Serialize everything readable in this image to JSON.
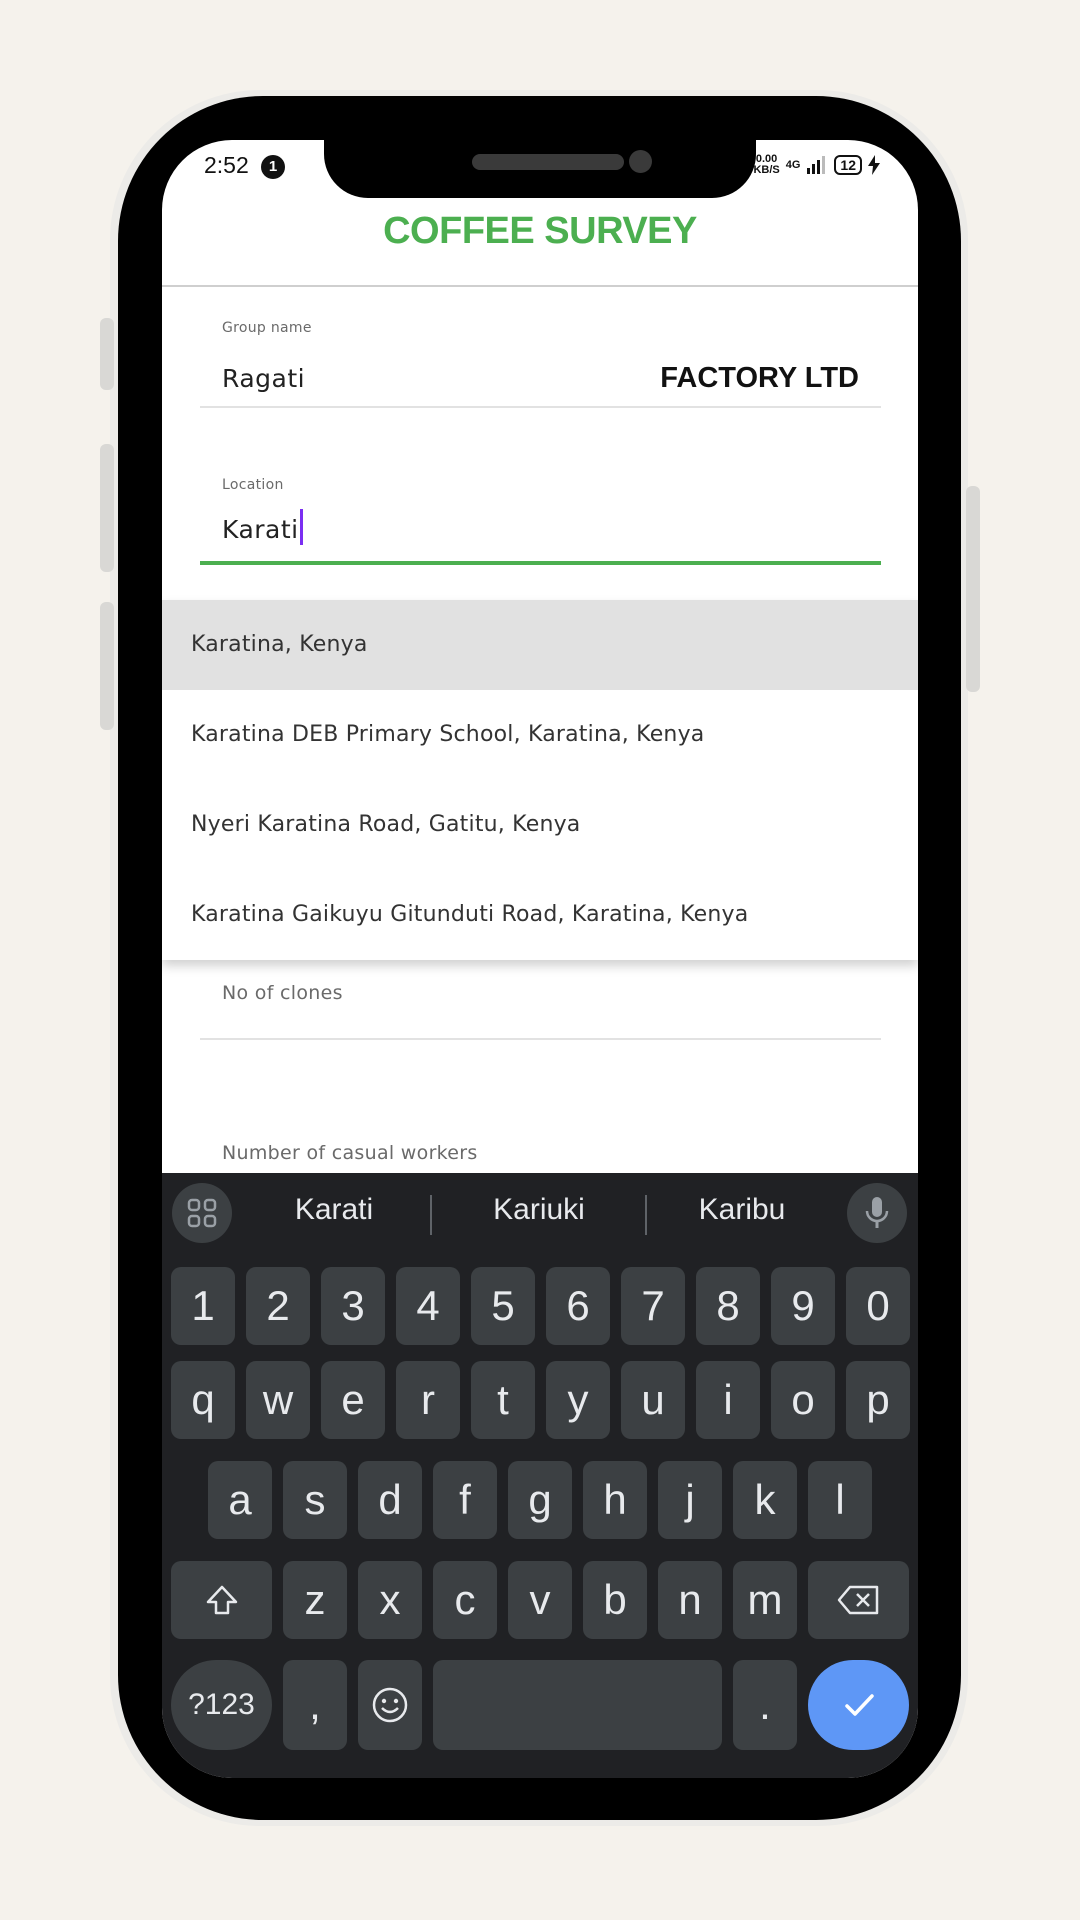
{
  "status_bar": {
    "time": "2:52",
    "notification_count": "1",
    "net_speed_top": "0.00",
    "net_speed_bottom": "KB/S",
    "network": "4G",
    "battery": "12"
  },
  "app": {
    "title": "COFFEE SURVEY",
    "accent_color": "#4caf50"
  },
  "form": {
    "group_name": {
      "label": "Group name",
      "value_left": "Ragati",
      "value_right": "FACTORY LTD"
    },
    "location": {
      "label": "Location",
      "value": "Karati"
    },
    "clones": {
      "label": "No of clones"
    },
    "casual_workers": {
      "label": "Number of casual workers"
    }
  },
  "suggestions": [
    "Karatina, Kenya",
    "Karatina DEB Primary School, Karatina, Kenya",
    "Nyeri Karatina Road, Gatitu, Kenya",
    "Karatina Gaikuyu Gitunduti Road, Karatina, Kenya"
  ],
  "keyboard": {
    "suggestions": [
      "Karati",
      "Kariuki",
      "Karibu"
    ],
    "row_numbers": [
      "1",
      "2",
      "3",
      "4",
      "5",
      "6",
      "7",
      "8",
      "9",
      "0"
    ],
    "row1": [
      "q",
      "w",
      "e",
      "r",
      "t",
      "y",
      "u",
      "i",
      "o",
      "p"
    ],
    "row2": [
      "a",
      "s",
      "d",
      "f",
      "g",
      "h",
      "j",
      "k",
      "l"
    ],
    "row3": [
      "z",
      "x",
      "c",
      "v",
      "b",
      "n",
      "m"
    ],
    "symbols_label": "?123",
    "comma": ",",
    "period": ".",
    "enter_color": "#5e97f6"
  }
}
